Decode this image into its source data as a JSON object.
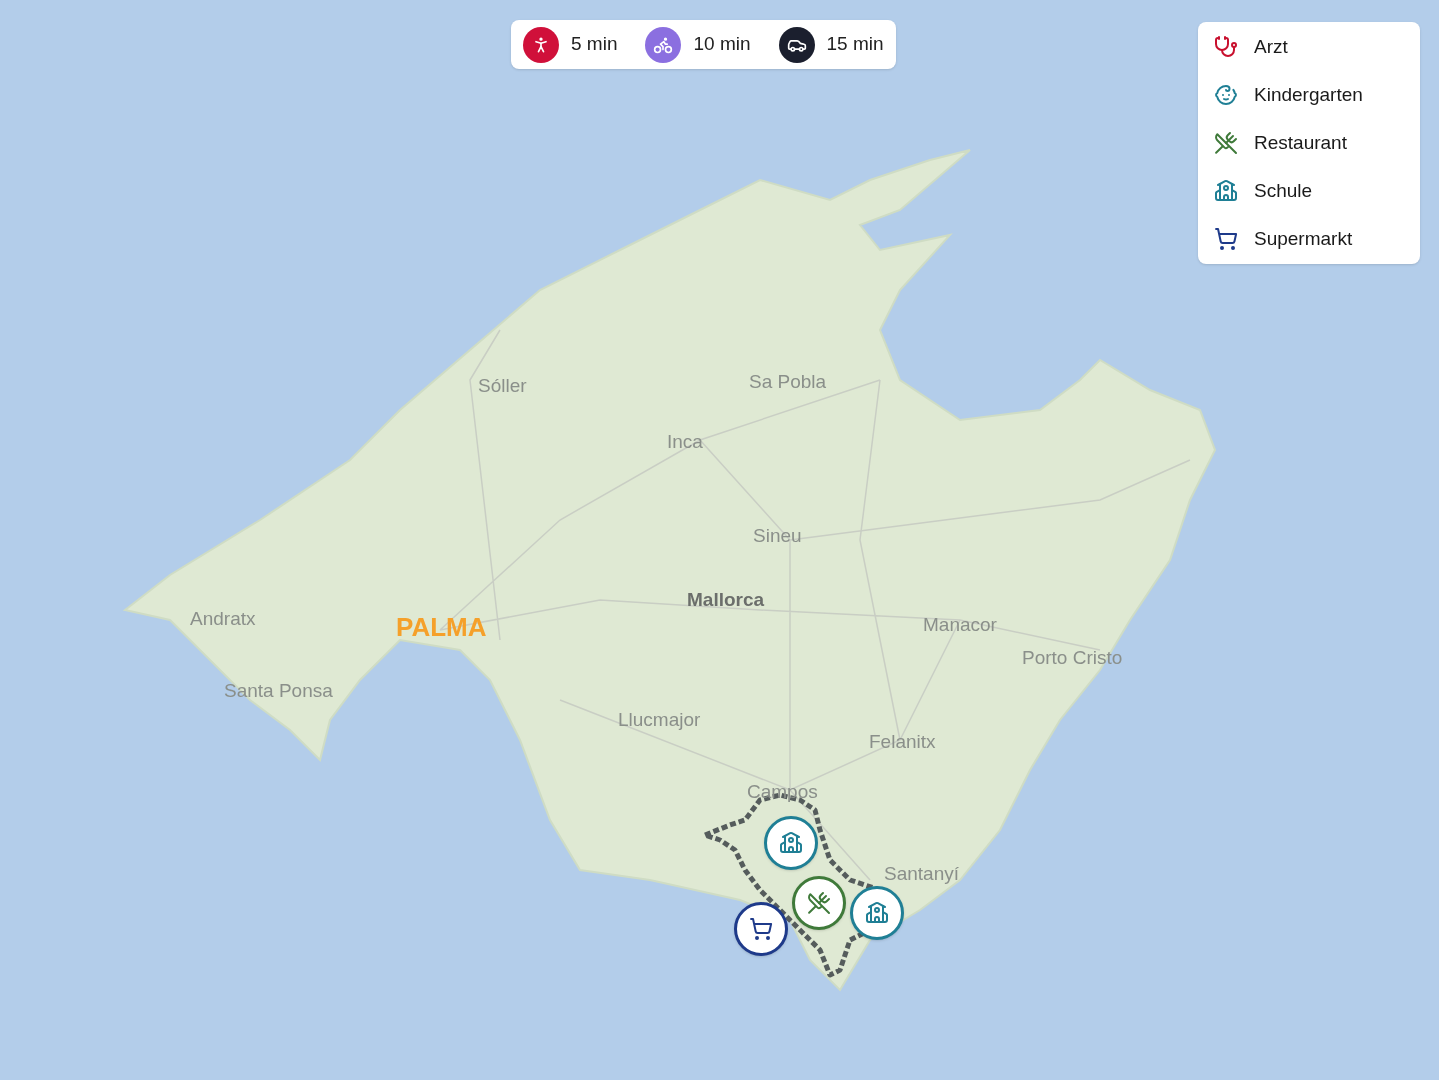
{
  "travel_modes": [
    {
      "kind": "walk",
      "label": "5 min",
      "color": "#d0103a"
    },
    {
      "kind": "bike",
      "label": "10 min",
      "color": "#8b6fe0"
    },
    {
      "kind": "car",
      "label": "15 min",
      "color": "#1b1f2e"
    }
  ],
  "legend": [
    {
      "kind": "doctor",
      "label": "Arzt"
    },
    {
      "kind": "kindergarten",
      "label": "Kindergarten"
    },
    {
      "kind": "restaurant",
      "label": "Restaurant"
    },
    {
      "kind": "school",
      "label": "Schule"
    },
    {
      "kind": "supermarket",
      "label": "Supermarkt"
    }
  ],
  "map": {
    "places": [
      {
        "name": "Sóller",
        "kind": "town"
      },
      {
        "name": "Sa Pobla",
        "kind": "town"
      },
      {
        "name": "Inca",
        "kind": "town"
      },
      {
        "name": "Sineu",
        "kind": "town"
      },
      {
        "name": "Mallorca",
        "kind": "region"
      },
      {
        "name": "Andratx",
        "kind": "town"
      },
      {
        "name": "PALMA",
        "kind": "city"
      },
      {
        "name": "Manacor",
        "kind": "town"
      },
      {
        "name": "Porto Cristo",
        "kind": "town"
      },
      {
        "name": "Santa Ponsa",
        "kind": "town"
      },
      {
        "name": "Llucmajor",
        "kind": "town"
      },
      {
        "name": "Felanitx",
        "kind": "town"
      },
      {
        "name": "Campos",
        "kind": "town"
      },
      {
        "name": "Santanyí",
        "kind": "town"
      }
    ],
    "markers": [
      {
        "kind": "supermarket"
      },
      {
        "kind": "school"
      },
      {
        "kind": "school"
      },
      {
        "kind": "restaurant"
      }
    ]
  }
}
